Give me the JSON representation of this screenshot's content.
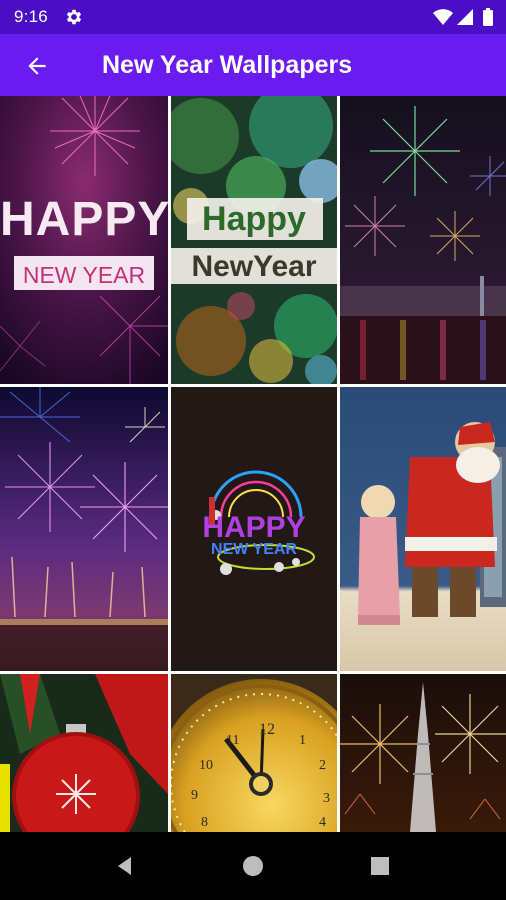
{
  "status_bar": {
    "time": "9:16",
    "icons": [
      "gear-icon",
      "wifi-icon",
      "signal-icon",
      "battery-icon"
    ],
    "color": "#4a0fc4"
  },
  "app_bar": {
    "title": "New Year Wallpapers",
    "back_icon": "arrow-back-icon",
    "color": "#6a1bf0"
  },
  "wallpapers": [
    {
      "id": "fireworks-happy-new-year",
      "line1": "HAPPY",
      "line2": "NEW YEAR"
    },
    {
      "id": "bokeh-happy-new-year",
      "line1": "Happy",
      "line2": "NewYear"
    },
    {
      "id": "city-fireworks"
    },
    {
      "id": "purple-fireworks-harbor"
    },
    {
      "id": "3d-happy-new-year",
      "line1": "HAPPY",
      "line2": "NEW YEAR"
    },
    {
      "id": "vintage-santa"
    },
    {
      "id": "red-ornament"
    },
    {
      "id": "golden-clock",
      "numerals": [
        "12",
        "11",
        "1",
        "10",
        "2",
        "9",
        "3",
        "8",
        "4"
      ]
    },
    {
      "id": "tower-fireworks"
    }
  ],
  "nav_bar": {
    "icons": [
      "back-triangle-icon",
      "home-circle-icon",
      "recents-square-icon"
    ]
  }
}
